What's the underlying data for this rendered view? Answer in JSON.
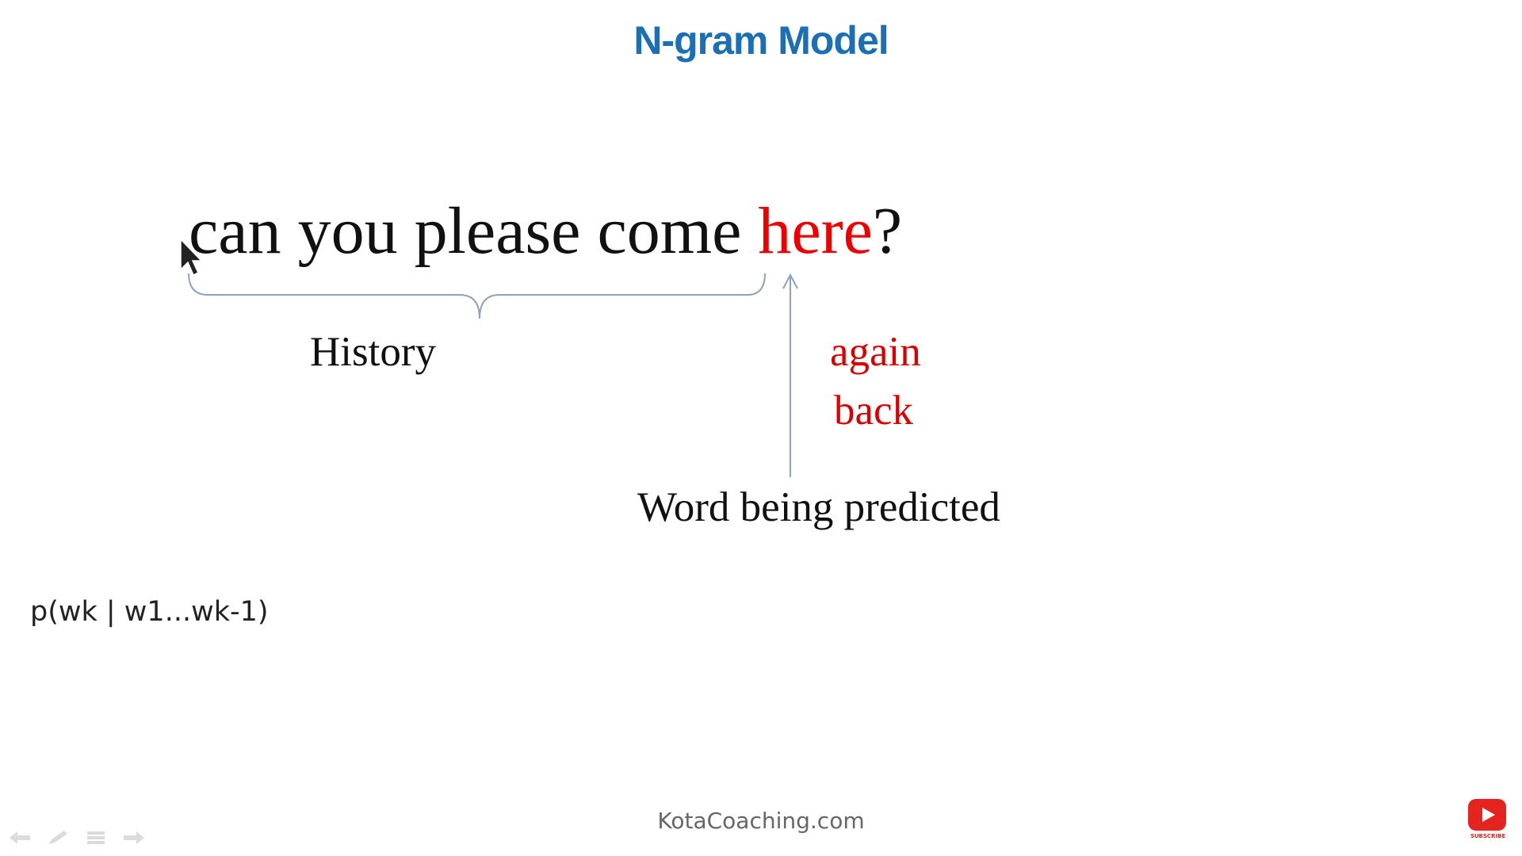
{
  "slide": {
    "title": "N-gram Model",
    "sentence": {
      "history": "can you please come ",
      "predicted": "here",
      "punct": "?"
    },
    "history_label": "History",
    "alternatives": [
      "again",
      "back"
    ],
    "predicted_label": "Word being predicted",
    "formula": "p(wk | w1...wk-1)",
    "footer": "KotaCoaching.com"
  },
  "youtube_badge": {
    "label": "SUBSCRIBE"
  },
  "colors": {
    "title": "#1a6fb5",
    "highlight": "#ee0000",
    "annotation_line": "#8fa2bd",
    "youtube_red": "#e52420"
  },
  "icons": {
    "cursor": "mouse-pointer-icon",
    "toolbar": [
      "back-arrow-icon",
      "pen-icon",
      "menu-icon",
      "forward-arrow-icon"
    ],
    "youtube": "youtube-play-icon"
  }
}
